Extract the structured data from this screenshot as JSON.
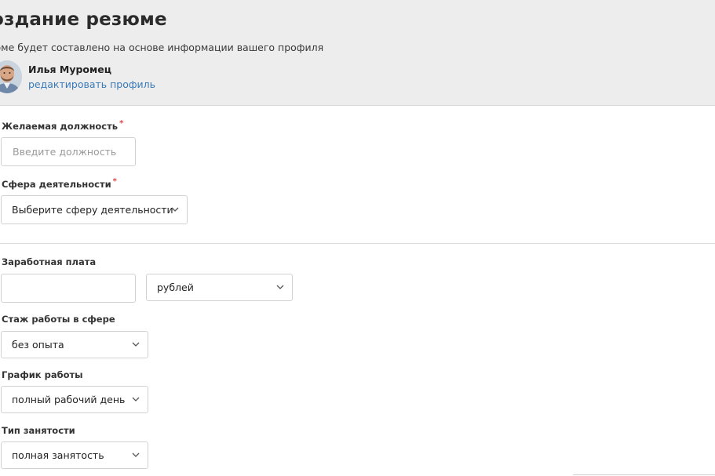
{
  "header": {
    "title": "оздание резюме",
    "subtitle": "зюме будет составлено на основе информации вашего профиля",
    "user_name": "Илья Муромец",
    "edit_link": "редактировать профиль"
  },
  "form": {
    "position": {
      "label": "Желаемая должность",
      "required_mark": "*",
      "placeholder": "Введите должность"
    },
    "sphere": {
      "label": "Сфера деятельности",
      "required_mark": "*",
      "value": "Выберите сферу деятельности"
    },
    "salary": {
      "label": "Заработная плата",
      "amount_value": "",
      "currency": "рублей"
    },
    "experience": {
      "label": "Стаж работы в сфере",
      "value": "без опыта"
    },
    "schedule": {
      "label": "График работы",
      "value": "полный рабочий день"
    },
    "employment": {
      "label": "Тип занятости",
      "value": "полная занятость"
    }
  },
  "colors": {
    "header_bg": "#ededed",
    "link": "#3a7ab8",
    "required": "#e04646",
    "border": "#d2d2d2"
  },
  "icons": {
    "avatar": "avatar",
    "dropdown": "chevron-down-icon"
  }
}
